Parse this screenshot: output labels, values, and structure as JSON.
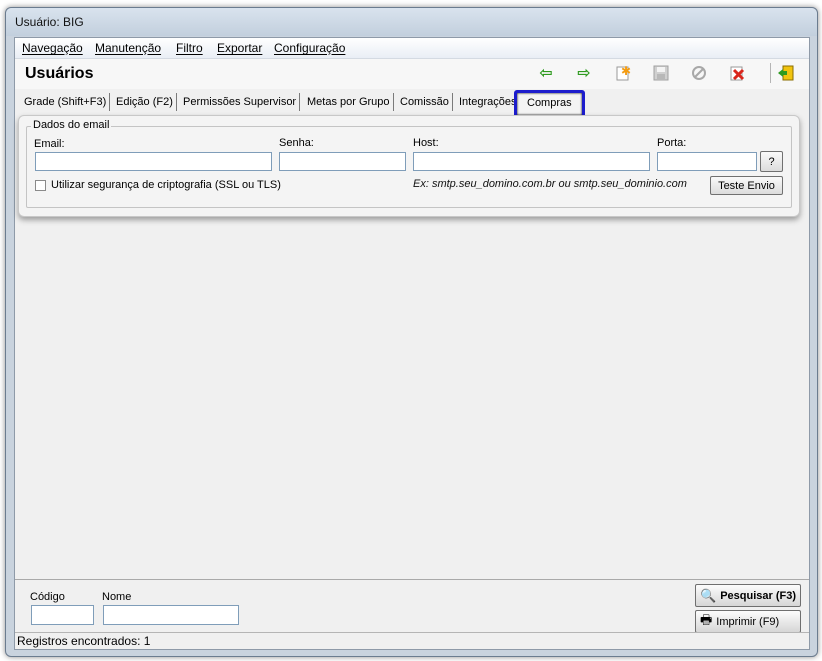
{
  "window": {
    "title": "Usuário: BIG"
  },
  "menu": {
    "items": [
      "Navegação",
      "Manutenção",
      "Filtro",
      "Exportar",
      "Configuração"
    ]
  },
  "header": {
    "title": "Usuários"
  },
  "toolbar": {
    "icons": [
      "back-arrow-icon",
      "forward-arrow-icon",
      "new-record-icon",
      "save-icon",
      "cancel-icon",
      "delete-icon",
      "exit-icon"
    ],
    "colors": {
      "arrow": "#2e9a1f",
      "new": "#f39c12",
      "delete": "#d9261c",
      "disabled": "#a8a8a8"
    }
  },
  "tabs": [
    "Grade (Shift+F3)",
    "Edição (F2)",
    "Permissões Supervisor",
    "Metas por Grupo",
    "Comissão",
    "Integrações",
    "Compras"
  ],
  "active_tab": "Compras",
  "email_panel": {
    "group_title": "Dados do email",
    "email_label": "Email:",
    "email_value": "",
    "senha_label": "Senha:",
    "senha_value": "",
    "host_label": "Host:",
    "host_value": "",
    "porta_label": "Porta:",
    "porta_value": "",
    "help_button": "?",
    "ssl_label": "Utilizar segurança de criptografia (SSL ou TLS)",
    "ssl_checked": false,
    "host_hint": "Ex: smtp.seu_domino.com.br ou smtp.seu_dominio.com",
    "test_button": "Teste Envio"
  },
  "search": {
    "codigo_label": "Código",
    "codigo_value": "",
    "nome_label": "Nome",
    "nome_value": "",
    "search_button": "Pesquisar (F3)",
    "print_button": "Imprimir (F9)"
  },
  "status": {
    "text": "Registros encontrados: 1"
  },
  "colors": {
    "active_tab_border": "#1c1ccc",
    "window_frame": "#c9d3de"
  }
}
